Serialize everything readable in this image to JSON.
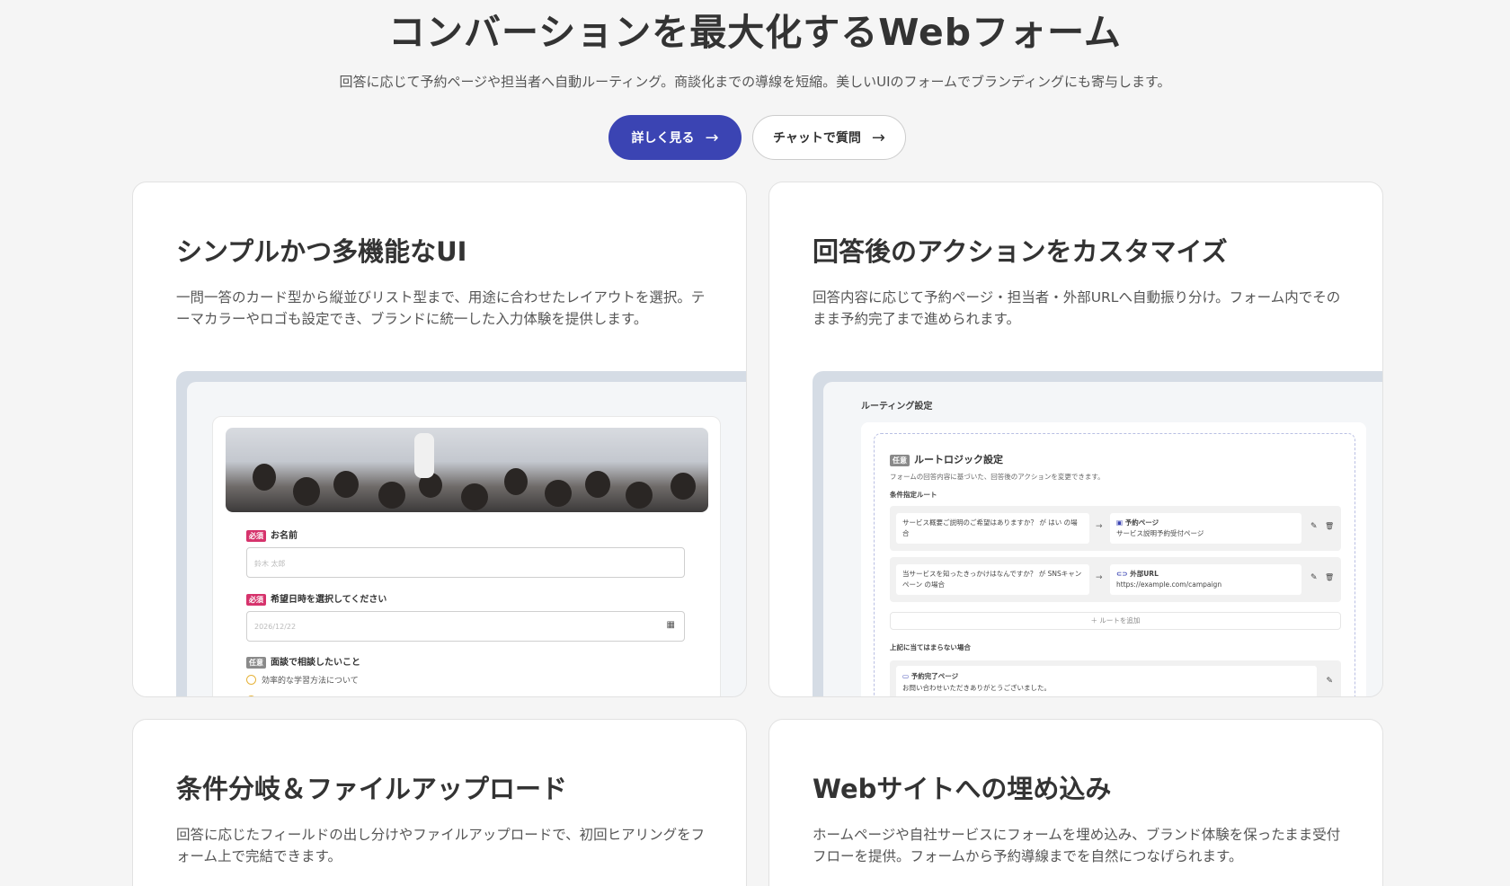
{
  "hero": {
    "title": "コンバーションを最大化するWebフォーム",
    "subtitle": "回答に応じて予約ページや担当者へ自動ルーティング。商談化までの導線を短縮。美しいUIのフォームでブランディングにも寄与します。",
    "primary_button": "詳しく見る",
    "secondary_button": "チャットで質問",
    "arrow_icon": "→",
    "accent_color": "#3b44b3"
  },
  "cards": [
    {
      "title": "シンプルかつ多機能なUI",
      "description": "一問一答のカード型から縦並びリスト型まで、用途に合わせたレイアウトを選択。テーマカラーやロゴも設定でき、ブランドに統一した入力体験を提供します。"
    },
    {
      "title": "回答後のアクションをカスタマイズ",
      "description": "回答内容に応じて予約ページ・担当者・外部URLへ自動振り分け。フォーム内でそのまま予約完了まで進められます。"
    },
    {
      "title": "条件分岐＆ファイルアップロード",
      "description": "回答に応じたフィールドの出し分けやファイルアップロードで、初回ヒアリングをフォーム上で完結できます。"
    },
    {
      "title": "Webサイトへの埋め込み",
      "description": "ホームページや自社サービスにフォームを埋め込み、ブランド体験を保ったまま受付フローを提供。フォームから予約導線までを自然につなげられます。"
    }
  ],
  "form_mock": {
    "required_tag": "必須",
    "optional_tag": "任意",
    "name_label": "お名前",
    "name_placeholder": "鈴木 太郎",
    "date_label": "希望日時を選択してください",
    "date_value": "2026/12/22",
    "calendar_icon": "▦",
    "topic_label": "面談で相談したいこと",
    "radio_option_1": "効率的な学習方法について"
  },
  "routing_mock": {
    "window_title": "ルーティング設定",
    "tag": "任意",
    "heading": "ルートロジック設定",
    "description": "フォームの回答内容に基づいた、回答後のアクションを変更できます。",
    "section_conditional": "条件指定ルート",
    "rules": [
      {
        "condition": "サービス概要ご説明のご希望はありますか？ が はい の場合",
        "arrow": "→",
        "dest_icon": "▣",
        "dest_type": "予約ページ",
        "dest_value": "サービス説明予約受付ページ"
      },
      {
        "condition": "当サービスを知ったきっかけはなんですか？ が SNSキャンペーン の場合",
        "arrow": "→",
        "dest_icon": "⊂⊃",
        "dest_type": "外部URL",
        "dest_value": "https://example.com/campaign"
      }
    ],
    "edit_icon": "✎",
    "delete_icon": "🗑",
    "add_route": "＋ ルートを追加",
    "section_fallback": "上記に当てはまらない場合",
    "fallback_icon": "▭",
    "fallback_type": "予約完了ページ",
    "fallback_value": "お問い合わせいただきありがとうございました。"
  }
}
